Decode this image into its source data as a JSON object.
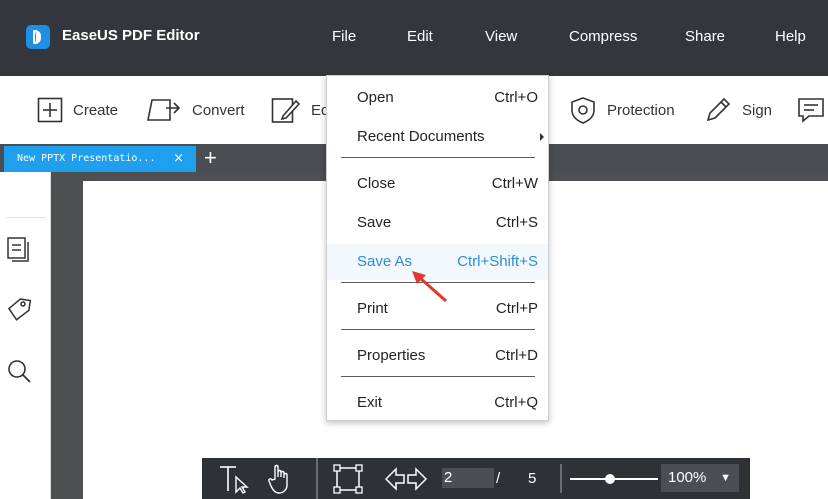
{
  "app": {
    "name": "EaseUS PDF Editor"
  },
  "menubar": [
    "File",
    "Edit",
    "View",
    "Compress",
    "Share",
    "Help"
  ],
  "toolbar": {
    "create": "Create",
    "convert": "Convert",
    "edit_partial": "Ed",
    "protection": "Protection",
    "sign": "Sign"
  },
  "tab": {
    "title": "New PPTX Presentatio...",
    "close": "×",
    "add": "+"
  },
  "file_menu": {
    "items": [
      {
        "label": "Open",
        "shortcut": "Ctrl+O"
      },
      {
        "label": "Recent Documents",
        "shortcut": ""
      },
      {
        "label": "Close",
        "shortcut": "Ctrl+W"
      },
      {
        "label": "Save",
        "shortcut": "Ctrl+S"
      },
      {
        "label": "Save As",
        "shortcut": "Ctrl+Shift+S"
      },
      {
        "label": "Print",
        "shortcut": "Ctrl+P"
      },
      {
        "label": "Properties",
        "shortcut": "Ctrl+D"
      },
      {
        "label": "Exit",
        "shortcut": "Ctrl+Q"
      }
    ]
  },
  "bottom_bar": {
    "current_page": "2",
    "page_separator": "/",
    "total_pages": "5",
    "zoom": "100%",
    "zoom_level_fraction": 0.45
  },
  "colors": {
    "titlebar": "#33373d",
    "accent": "#1ea0ee",
    "highlight_text": "#2b8ed9",
    "annotation_arrow": "#e0392b"
  }
}
